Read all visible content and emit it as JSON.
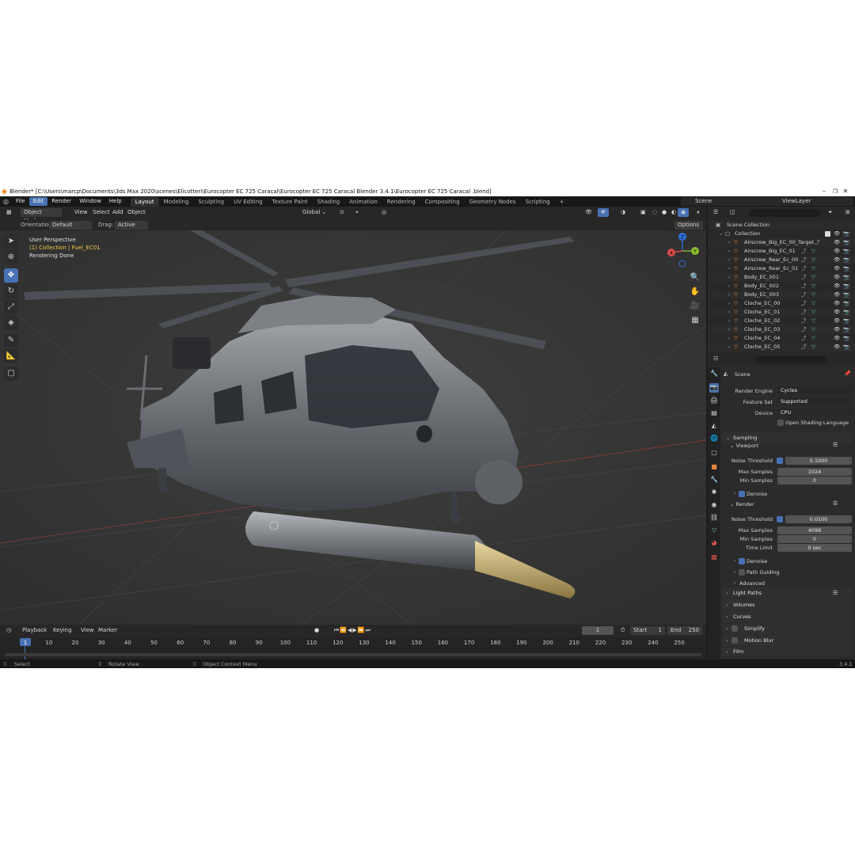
{
  "window": {
    "title": "Blender* [C:\\Users\\marcp\\Documents\\3ds Max 2020\\scenes\\Elicotteri\\Eurocopter EC 725 Caracal\\Eurocopter EC 725 Caracal Blender 3.4.1\\Eurocopter EC 725 Caracal .blend]",
    "minimize": "–",
    "maximize": "❐",
    "close": "✕"
  },
  "menu": [
    "File",
    "Edit",
    "Render",
    "Window",
    "Help"
  ],
  "workspaces": [
    "Layout",
    "Modeling",
    "Sculpting",
    "UV Editing",
    "Texture Paint",
    "Shading",
    "Animation",
    "Rendering",
    "Compositing",
    "Geometry Nodes",
    "Scripting",
    "+"
  ],
  "scene_field": "Scene",
  "viewlayer_field": "ViewLayer",
  "viewport_header": {
    "mode": "Object Mode",
    "menus": [
      "View",
      "Select",
      "Add",
      "Object"
    ],
    "transform": "Global",
    "orientation_label": "Orientation:",
    "orientation_value": "Default",
    "drag_label": "Drag:",
    "drag_value": "Active Tool",
    "options": "Options"
  },
  "viewport_overlay": {
    "perspective": "User Perspective",
    "collection": "(1) Collection | Fuel_EC01",
    "status": "Rendering Done"
  },
  "gizmo": {
    "x": "X",
    "y": "Y",
    "z": "Z"
  },
  "outliner": {
    "scene_collection": "Scene Collection",
    "collection": "Collection",
    "items": [
      "Airscrew_Big_EC_00_Target",
      "Airscrew_Big_EC_01",
      "Airscrew_Rear_Ec_00",
      "Airscrew_Rear_Ec_01",
      "Body_EC_001",
      "Body_EC_002",
      "Body_EC_003",
      "Cloche_EC_00",
      "Cloche_EC_01",
      "Cloche_EC_02",
      "Cloche_EC_03",
      "Cloche_EC_04",
      "Cloche_EC_05"
    ]
  },
  "properties": {
    "context": "Scene",
    "render_engine_label": "Render Engine",
    "render_engine": "Cycles",
    "feature_set_label": "Feature Set",
    "feature_set": "Supported",
    "device_label": "Device",
    "device": "CPU",
    "osl_label": "Open Shading Language",
    "sampling": "Sampling",
    "viewport": "Viewport",
    "vp_noise_label": "Noise Threshold",
    "vp_noise": "0.1000",
    "vp_max_label": "Max Samples",
    "vp_max": "1024",
    "vp_min_label": "Min Samples",
    "vp_min": "0",
    "denoise": "Denoise",
    "render": "Render",
    "r_noise_label": "Noise Threshold",
    "r_noise": "0.0100",
    "r_max_label": "Max Samples",
    "r_max": "4096",
    "r_min_label": "Min Samples",
    "r_min": "0",
    "time_limit_label": "Time Limit",
    "time_limit": "0 sec",
    "r_denoise": "Denoise",
    "path_guiding": "Path Guiding",
    "advanced": "Advanced",
    "light_paths": "Light Paths",
    "volumes": "Volumes",
    "curves": "Curves",
    "simplify": "Simplify",
    "motion_blur": "Motion Blur",
    "film": "Film"
  },
  "timeline": {
    "menus": [
      "Playback",
      "Keying",
      "View",
      "Marker"
    ],
    "current_frame": "1",
    "start_label": "Start",
    "start": "1",
    "end_label": "End",
    "end": "250",
    "ticks": [
      "1",
      "10",
      "20",
      "30",
      "40",
      "50",
      "60",
      "70",
      "80",
      "90",
      "100",
      "110",
      "120",
      "130",
      "140",
      "150",
      "160",
      "170",
      "180",
      "190",
      "200",
      "210",
      "220",
      "230",
      "240",
      "250"
    ]
  },
  "statusbar": {
    "select": "Select",
    "rotate": "Rotate View",
    "context_menu": "Object Context Menu",
    "version": "3.4.1"
  },
  "colors": {
    "accent": "#4772b3",
    "viewport_bg": "#393939",
    "panel_bg": "#2b2b2b",
    "orange_mesh": "#e8853b",
    "green_mod": "#5fbfa0"
  }
}
